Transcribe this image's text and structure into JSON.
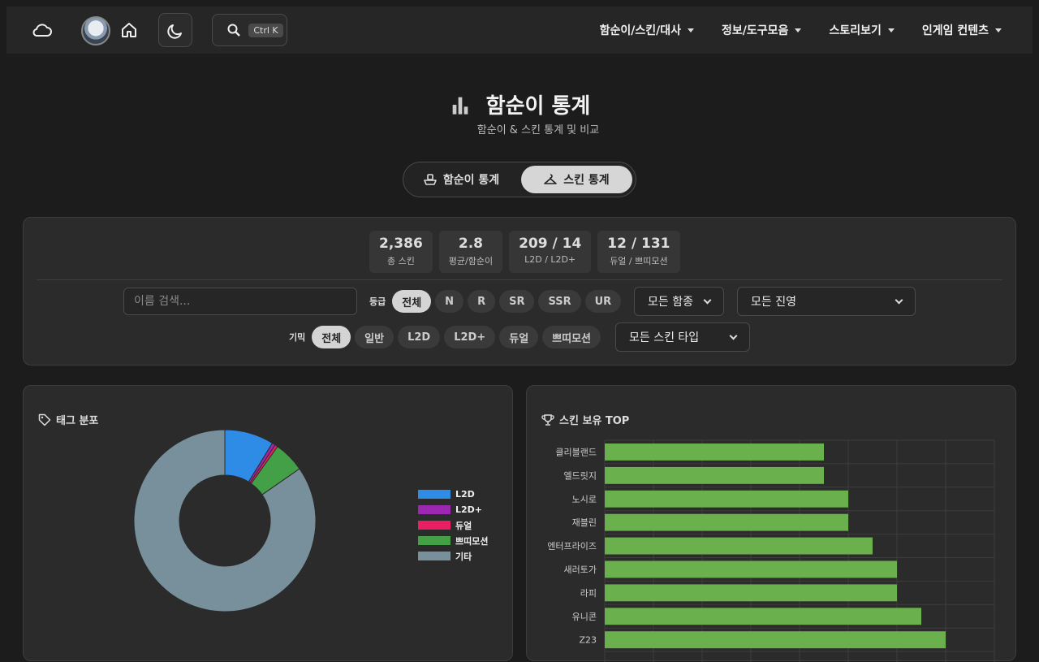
{
  "nav": {
    "search_shortcut": "Ctrl K",
    "menu": [
      {
        "label": "함순이/스킨/대사"
      },
      {
        "label": "정보/도구모음"
      },
      {
        "label": "스토리보기"
      },
      {
        "label": "인게임 컨텐츠"
      }
    ]
  },
  "hero": {
    "title": "함순이 통계",
    "subtitle": "함순이 & 스킨 통계 및 비교"
  },
  "tabs": {
    "ship": "함순이 통계",
    "skin": "스킨 통계",
    "active": "skin"
  },
  "stats": [
    {
      "value": "2,386",
      "label": "총 스킨"
    },
    {
      "value": "2.8",
      "label": "평균/함순이"
    },
    {
      "value": "209 / 14",
      "label": "L2D / L2D+"
    },
    {
      "value": "12 / 131",
      "label": "듀얼 / 쁘띠모션"
    }
  ],
  "filters": {
    "search_placeholder": "이름 검색...",
    "grade_label": "등급",
    "grades": [
      "전체",
      "N",
      "R",
      "SR",
      "SSR",
      "UR"
    ],
    "grade_selected": "전체",
    "ship_type_select": "모든 함종",
    "faction_select": "모든 진영",
    "feature_label": "기믹",
    "features": [
      "전체",
      "일반",
      "L2D",
      "L2D+",
      "듀얼",
      "쁘띠모션"
    ],
    "feature_selected": "전체",
    "skin_type_select": "모든 스킨 타입"
  },
  "tag_card": {
    "title": "태그 분포"
  },
  "top_card": {
    "title": "스킨 보유 TOP"
  },
  "colors": {
    "l2d": "#2f8ce6",
    "l2dplus": "#9c27b0",
    "dual": "#e91e63",
    "petit": "#43a047",
    "other": "#78909c",
    "bar": "#6ab04c"
  },
  "chart_data": [
    {
      "type": "pie",
      "title": "태그 분포",
      "categories": [
        "L2D",
        "L2D+",
        "듀얼",
        "쁘띠모션",
        "기타"
      ],
      "values": [
        209,
        14,
        12,
        131,
        2020
      ],
      "legend": "right"
    },
    {
      "type": "bar",
      "orientation": "horizontal",
      "title": "스킨 보유 TOP",
      "categories": [
        "클리블랜드",
        "엘드릿지",
        "노시로",
        "재블린",
        "엔터프라이즈",
        "새러토가",
        "라피",
        "유니콘",
        "Z23"
      ],
      "values": [
        9,
        9,
        10,
        10,
        11,
        12,
        12,
        13,
        14
      ],
      "xlim": [
        0,
        16
      ],
      "grid": true
    }
  ]
}
